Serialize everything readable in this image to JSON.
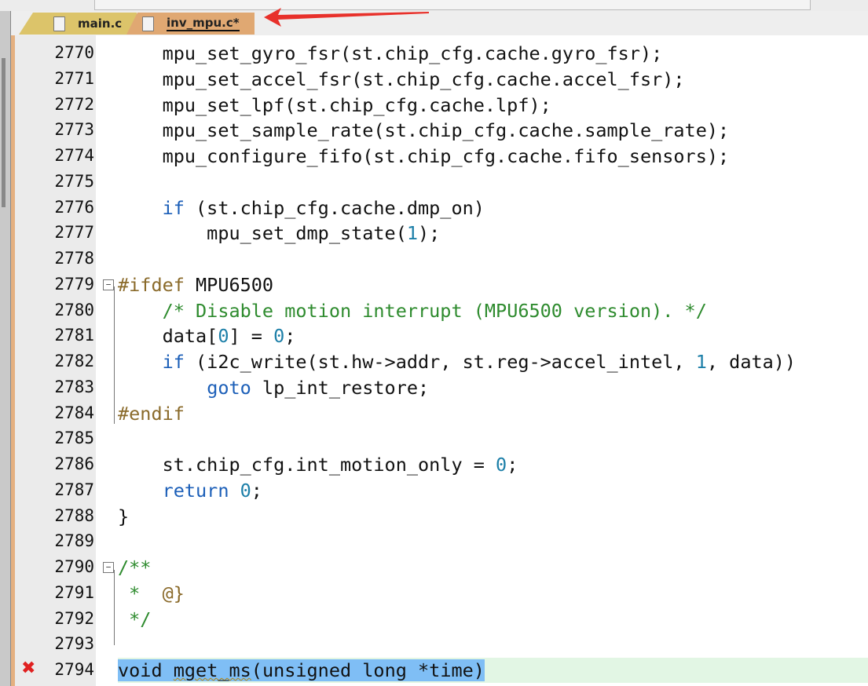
{
  "tabs": [
    {
      "label": "main.c",
      "active": false
    },
    {
      "label": "inv_mpu.c*",
      "active": true
    }
  ],
  "annotation": {
    "arrow_color": "#e8302a"
  },
  "editor": {
    "error_line": 2794,
    "lines": [
      {
        "n": "2770",
        "t": [
          [
            "    mpu_set_gyro_fsr(st.chip_cfg.cache.gyro_fsr);",
            ""
          ]
        ]
      },
      {
        "n": "2771",
        "t": [
          [
            "    mpu_set_accel_fsr(st.chip_cfg.cache.accel_fsr);",
            ""
          ]
        ]
      },
      {
        "n": "2772",
        "t": [
          [
            "    mpu_set_lpf(st.chip_cfg.cache.lpf);",
            ""
          ]
        ]
      },
      {
        "n": "2773",
        "t": [
          [
            "    mpu_set_sample_rate(st.chip_cfg.cache.sample_rate);",
            ""
          ]
        ]
      },
      {
        "n": "2774",
        "t": [
          [
            "    mpu_configure_fifo(st.chip_cfg.cache.fifo_sensors);",
            ""
          ]
        ]
      },
      {
        "n": "2775",
        "t": []
      },
      {
        "n": "2776",
        "t": [
          [
            "    ",
            ""
          ],
          [
            "if",
            "kw"
          ],
          [
            " (st.chip_cfg.cache.dmp_on)",
            ""
          ]
        ]
      },
      {
        "n": "2777",
        "t": [
          [
            "        mpu_set_dmp_state(",
            ""
          ],
          [
            "1",
            "num"
          ],
          [
            ");",
            ""
          ]
        ]
      },
      {
        "n": "2778",
        "t": []
      },
      {
        "n": "2779",
        "fold": true,
        "t": [
          [
            "#ifdef",
            "pp"
          ],
          [
            " MPU6500",
            ""
          ]
        ]
      },
      {
        "n": "2780",
        "t": [
          [
            "    ",
            ""
          ],
          [
            "/* Disable motion interrupt (MPU6500 version). */",
            "cm"
          ]
        ]
      },
      {
        "n": "2781",
        "t": [
          [
            "    data[",
            ""
          ],
          [
            "0",
            "num"
          ],
          [
            "] = ",
            ""
          ],
          [
            "0",
            "num"
          ],
          [
            ";",
            ""
          ]
        ]
      },
      {
        "n": "2782",
        "t": [
          [
            "    ",
            ""
          ],
          [
            "if",
            "kw"
          ],
          [
            " (i2c_write(st.hw->addr, st.reg->accel_intel, ",
            ""
          ],
          [
            "1",
            "num"
          ],
          [
            ", data))",
            ""
          ]
        ]
      },
      {
        "n": "2783",
        "t": [
          [
            "        ",
            ""
          ],
          [
            "goto",
            "kw"
          ],
          [
            " lp_int_restore;",
            ""
          ]
        ]
      },
      {
        "n": "2784",
        "t": [
          [
            "#endif",
            "pp"
          ]
        ]
      },
      {
        "n": "2785",
        "t": []
      },
      {
        "n": "2786",
        "t": [
          [
            "    st.chip_cfg.int_motion_only = ",
            ""
          ],
          [
            "0",
            "num"
          ],
          [
            ";",
            ""
          ]
        ]
      },
      {
        "n": "2787",
        "t": [
          [
            "    ",
            ""
          ],
          [
            "return",
            "kw"
          ],
          [
            " ",
            ""
          ],
          [
            "0",
            "num"
          ],
          [
            ";",
            ""
          ]
        ]
      },
      {
        "n": "2788",
        "t": [
          [
            "}",
            ""
          ]
        ]
      },
      {
        "n": "2789",
        "t": []
      },
      {
        "n": "2790",
        "fold": true,
        "t": [
          [
            "/**",
            "cm"
          ]
        ]
      },
      {
        "n": "2791",
        "t": [
          [
            " *  ",
            "cm"
          ],
          [
            "@}",
            "at"
          ]
        ]
      },
      {
        "n": "2792",
        "t": [
          [
            " */",
            "cm"
          ]
        ]
      },
      {
        "n": "2793",
        "t": []
      },
      {
        "n": "2794",
        "error": true,
        "t": [
          [
            "void ",
            "hl"
          ],
          [
            "mget_ms",
            "hl squig"
          ],
          [
            "(unsigned long *time)",
            "hl"
          ]
        ]
      }
    ]
  }
}
